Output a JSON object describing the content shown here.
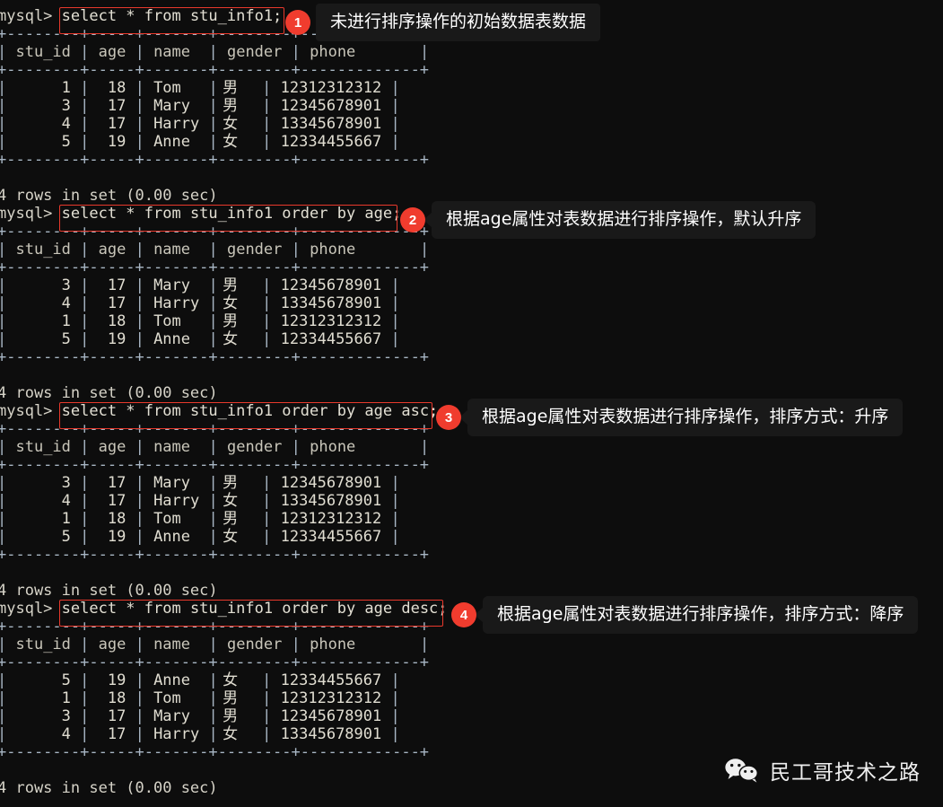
{
  "meta": {
    "app": "mysql-cli-terminal",
    "background_color": "#0d0d0d",
    "text_color": "#d6d3c8",
    "accent_color": "#f03c2e",
    "callout_bg": "#191919"
  },
  "prompt": "mysql>",
  "status_line": "4 rows in set (0.00 sec)",
  "table": {
    "headers": [
      "stu_id",
      "age",
      "name",
      "gender",
      "phone"
    ],
    "rule": "+--------+-----+-------+--------+-------------+",
    "header_row": "| stu_id | age | name  | gender | phone       |"
  },
  "blocks": [
    {
      "id": 1,
      "badge": "1",
      "sql": "select * from stu_info1;",
      "annotation": "未进行排序操作的初始数据表数据",
      "rows": [
        {
          "stu_id": "1",
          "age": "18",
          "name": "Tom",
          "gender": "男",
          "phone": "12312312312"
        },
        {
          "stu_id": "3",
          "age": "17",
          "name": "Mary",
          "gender": "男",
          "phone": "12345678901"
        },
        {
          "stu_id": "4",
          "age": "17",
          "name": "Harry",
          "gender": "女",
          "phone": "13345678901"
        },
        {
          "stu_id": "5",
          "age": "19",
          "name": "Anne",
          "gender": "女",
          "phone": "12334455667"
        }
      ],
      "status": "4 rows in set (0.00 sec)"
    },
    {
      "id": 2,
      "badge": "2",
      "sql": "select * from stu_info1 order by age;",
      "annotation": "根据age属性对表数据进行排序操作，默认升序",
      "rows": [
        {
          "stu_id": "3",
          "age": "17",
          "name": "Mary",
          "gender": "男",
          "phone": "12345678901"
        },
        {
          "stu_id": "4",
          "age": "17",
          "name": "Harry",
          "gender": "女",
          "phone": "13345678901"
        },
        {
          "stu_id": "1",
          "age": "18",
          "name": "Tom",
          "gender": "男",
          "phone": "12312312312"
        },
        {
          "stu_id": "5",
          "age": "19",
          "name": "Anne",
          "gender": "女",
          "phone": "12334455667"
        }
      ],
      "status": "4 rows in set (0.00 sec)"
    },
    {
      "id": 3,
      "badge": "3",
      "sql": "select * from stu_info1 order by age asc;",
      "annotation": "根据age属性对表数据进行排序操作，排序方式：升序",
      "rows": [
        {
          "stu_id": "3",
          "age": "17",
          "name": "Mary",
          "gender": "男",
          "phone": "12345678901"
        },
        {
          "stu_id": "4",
          "age": "17",
          "name": "Harry",
          "gender": "女",
          "phone": "13345678901"
        },
        {
          "stu_id": "1",
          "age": "18",
          "name": "Tom",
          "gender": "男",
          "phone": "12312312312"
        },
        {
          "stu_id": "5",
          "age": "19",
          "name": "Anne",
          "gender": "女",
          "phone": "12334455667"
        }
      ],
      "status": "4 rows in set (0.00 sec)"
    },
    {
      "id": 4,
      "badge": "4",
      "sql": "select * from stu_info1 order by age desc;",
      "annotation": "根据age属性对表数据进行排序操作，排序方式：降序",
      "rows": [
        {
          "stu_id": "5",
          "age": "19",
          "name": "Anne",
          "gender": "女",
          "phone": "12334455667"
        },
        {
          "stu_id": "1",
          "age": "18",
          "name": "Tom",
          "gender": "男",
          "phone": "12312312312"
        },
        {
          "stu_id": "3",
          "age": "17",
          "name": "Mary",
          "gender": "男",
          "phone": "12345678901"
        },
        {
          "stu_id": "4",
          "age": "17",
          "name": "Harry",
          "gender": "女",
          "phone": "13345678901"
        }
      ],
      "status": "4 rows in set (0.00 sec)"
    }
  ],
  "watermark": {
    "icon": "wechat-icon",
    "label": "民工哥技术之路"
  }
}
